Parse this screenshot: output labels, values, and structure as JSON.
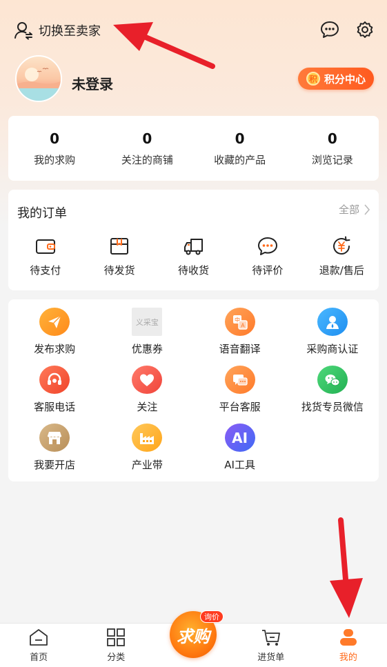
{
  "header": {
    "switch_label": "切换至卖家",
    "message_icon": "chat-bubble-icon",
    "settings_icon": "gear-icon"
  },
  "profile": {
    "username": "未登录",
    "points_label": "积分中心",
    "points_coin": "积"
  },
  "stats": [
    {
      "value": "0",
      "label": "我的求购"
    },
    {
      "value": "0",
      "label": "关注的商铺"
    },
    {
      "value": "0",
      "label": "收藏的产品"
    },
    {
      "value": "0",
      "label": "浏览记录"
    }
  ],
  "orders": {
    "title": "我的订单",
    "all_label": "全部",
    "items": [
      {
        "label": "待支付",
        "icon": "wallet-icon"
      },
      {
        "label": "待发货",
        "icon": "package-icon"
      },
      {
        "label": "待收货",
        "icon": "truck-icon"
      },
      {
        "label": "待评价",
        "icon": "comment-icon"
      },
      {
        "label": "退款/售后",
        "icon": "refund-icon"
      }
    ]
  },
  "tools": [
    {
      "label": "发布求购",
      "icon": "paper-plane-icon",
      "color": "#ff9f1a"
    },
    {
      "label": "优惠券",
      "icon": "coupon-placeholder-icon",
      "color": "#e9e9e9",
      "placeholder_text": "义采宝"
    },
    {
      "label": "语音翻译",
      "icon": "translate-icon",
      "color": "#ff8a3d"
    },
    {
      "label": "采购商认证",
      "icon": "user-badge-icon",
      "color": "#2aa3f5"
    },
    {
      "label": "客服电话",
      "icon": "headset-icon",
      "color": "#ff5a3a"
    },
    {
      "label": "关注",
      "icon": "heart-icon",
      "color": "#ff5a4a"
    },
    {
      "label": "平台客服",
      "icon": "chat-icon",
      "color": "#ff8a3d"
    },
    {
      "label": "找货专员微信",
      "icon": "wechat-icon",
      "color": "#2fc25b"
    },
    {
      "label": "我要开店",
      "icon": "shop-icon",
      "color": "#c9a26a"
    },
    {
      "label": "产业带",
      "icon": "factory-icon",
      "color": "#ffb43a"
    },
    {
      "label": "AI工具",
      "icon": "ai-icon",
      "color": "#5b63f5",
      "icon_text": "AI"
    }
  ],
  "bottom_nav": {
    "items": [
      {
        "label": "首页",
        "icon": "home-icon"
      },
      {
        "label": "分类",
        "icon": "grid-icon"
      },
      {
        "label": "进货单",
        "icon": "cart-icon"
      },
      {
        "label": "我的",
        "icon": "profile-icon"
      }
    ],
    "center_label": "求购",
    "center_badge": "询价",
    "active_index": 3
  },
  "colors": {
    "accent": "#ff6a1a",
    "annotation_arrow": "#e8202a"
  }
}
